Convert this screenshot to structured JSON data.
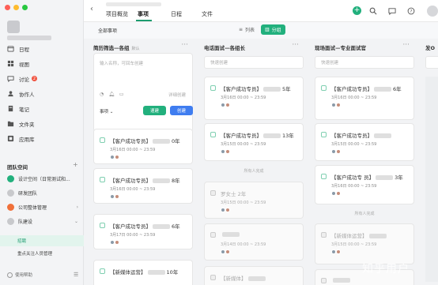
{
  "topbar": {
    "tabs": [
      {
        "label": "项目概览",
        "active": false
      },
      {
        "label": "事项",
        "active": true
      },
      {
        "label": "日程",
        "active": false
      },
      {
        "label": "文件",
        "active": false
      }
    ]
  },
  "sidebar": {
    "nav": [
      {
        "label": "日程",
        "icon": "calendar-icon"
      },
      {
        "label": "视图",
        "icon": "view-icon"
      },
      {
        "label": "讨论",
        "icon": "chat-icon",
        "badge": "2"
      },
      {
        "label": "协作人",
        "icon": "people-icon"
      },
      {
        "label": "笔记",
        "icon": "note-icon"
      },
      {
        "label": "文件夹",
        "icon": "folder-icon"
      },
      {
        "label": "应用库",
        "icon": "apps-icon"
      }
    ],
    "section_title": "团队空间",
    "teams": [
      {
        "label": "设计空间（日常测试和..."
      },
      {
        "label": "研发团队"
      },
      {
        "label": "公司整体管理"
      },
      {
        "label": "队建设"
      }
    ],
    "sub_items": [
      {
        "label": "招聘",
        "active": true
      },
      {
        "label": "重点关注人员管理",
        "active": false
      }
    ],
    "help": "使用帮助"
  },
  "toolbar": {
    "all_items": "全部事项",
    "view_list": "列表",
    "view_group": "分组"
  },
  "columns": [
    {
      "title": "简历筛选—各组",
      "tag": "默认",
      "new_card": {
        "placeholder": "输入名称，可回车创建",
        "detail": "详细创建",
        "type": "事项",
        "btn_direct": "速建",
        "btn_create": "创建"
      },
      "cards": [
        {
          "title_a": "【客户成功专员】",
          "title_b": "0年",
          "date": "3月16日 00:00 ~ 23:59",
          "done": false
        },
        {
          "title_a": "【客户成功专员】",
          "title_b": "8年",
          "date": "3月16日 00:00 ~ 23:59",
          "done": false
        },
        {
          "title_a": "【客户成功专员】",
          "title_b": "6年",
          "date": "3月17日 00:00 ~ 23:59",
          "done": false
        },
        {
          "title_a": "【新媒体运营】",
          "title_b": "10年",
          "date": "",
          "done": false
        }
      ]
    },
    {
      "title": "电话面试—各组长",
      "quick": "快速创建",
      "cards": [
        {
          "title_a": "【客户成功专员】",
          "title_b": "5年",
          "date": "3月16日 00:00 ~ 23:59",
          "done": false
        },
        {
          "title_a": "【客户成功专员】",
          "title_b": "13年",
          "date": "3月15日 00:00 ~ 23:59",
          "done": false
        },
        {
          "title_a": "罗女士 2年",
          "title_b": "",
          "date": "3月15日 00:00 ~ 23:59",
          "done": true
        },
        {
          "title_a": "",
          "title_b": "",
          "date": "3月14日 00:00 ~ 23:59",
          "done": true
        },
        {
          "title_a": "【新媒体】",
          "title_b": "",
          "date": "",
          "done": true
        }
      ],
      "all_done": "所有人完成"
    },
    {
      "title": "现场面试—专业面试官",
      "quick": "快速创建",
      "cards": [
        {
          "title_a": "【客户成功专员】",
          "title_b": "6年",
          "date": "3月16日 00:00 ~ 23:59",
          "done": false
        },
        {
          "title_a": "【客户成功专员】",
          "title_b": "",
          "date": "3月15日 00:00 ~ 23:59",
          "done": false
        },
        {
          "title_a": "【客户成功专 员】",
          "title_b": "3年",
          "date": "3月16日 00:00 ~ 23:59",
          "done": false
        },
        {
          "title_a": "【新媒体运营】",
          "title_b": "",
          "date": "3月15日 00:00 ~ 23:59",
          "done": true
        },
        {
          "title_a": "",
          "title_b": "",
          "date": "",
          "done": true
        }
      ],
      "all_done": "所有人完成"
    },
    {
      "title": "发O"
    }
  ],
  "watermark": "知乎用户"
}
